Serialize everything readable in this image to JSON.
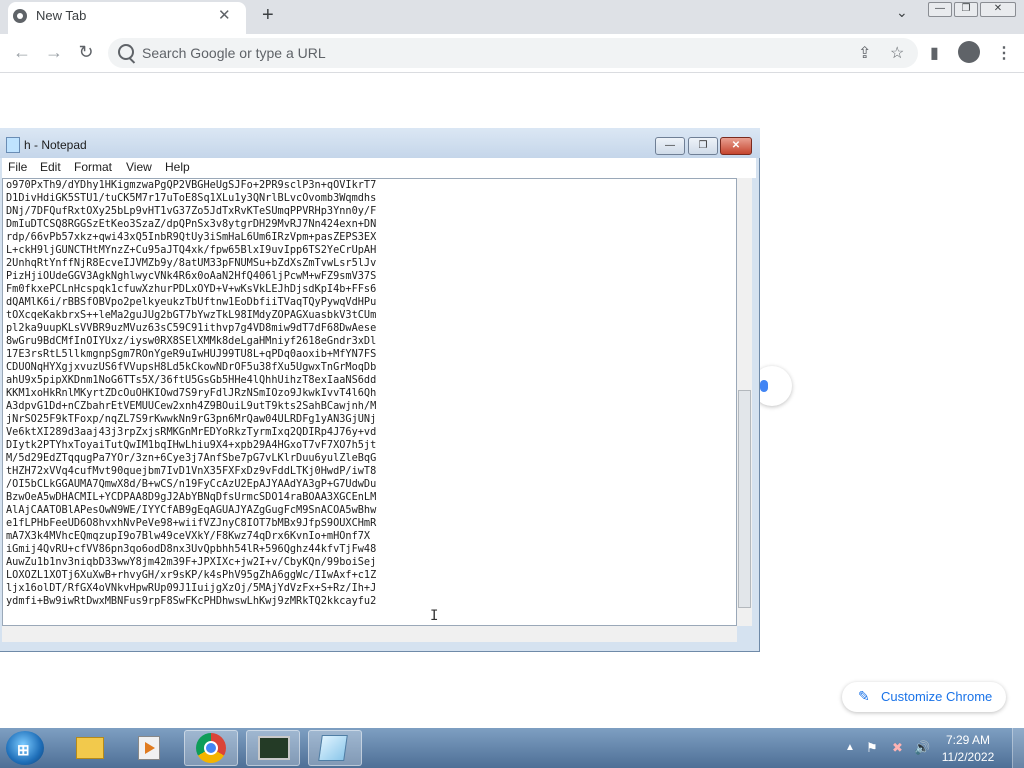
{
  "chrome": {
    "tab_title": "New Tab",
    "tab_close": "✕",
    "new_tab": "+",
    "tab_search": "⌄",
    "window_controls": [
      "—",
      "❐",
      "✕"
    ],
    "back": "←",
    "forward": "→",
    "reload": "↻",
    "omnibox_placeholder": "Search Google or type a URL",
    "share": "⇪",
    "bookmark": "☆",
    "side_panel": "▮",
    "menu": "⋮",
    "customize_label": "Customize Chrome",
    "customize_icon": "✎"
  },
  "notepad": {
    "title": "h - Notepad",
    "menu": [
      "File",
      "Edit",
      "Format",
      "View",
      "Help"
    ],
    "minimize": "—",
    "maximize": "❐",
    "close": "✕",
    "text": "o970PxTh9/dYDhy1HKigmzwaPgQP2VBGHeUgSJFo+2PR9sclP3n+qOVIkrT7\nD1DivHdiGK5STU1/tuCK5M7r17uToE8Sq1XLu1y3QNrlBLvcOvomb3Wqmdhs\nDNj/7DFQufRxtOXy25bLp9vHT1vG37Zo5JdTxRvKTeSUmqPPVRHp3Ynn0y/F\nDmIuDTCSQ8RGGSzEtKeo3SzaZ/dpQPnSx3v8ytgrDH29MvRJ7Nn424exn+DN\nrdp/66vPb57xkz+qwi43xQ5InbR9QtUy3iSmHaL6Um6IRzVpm+pasZEPS3EX\nL+ckH9ljGUNCTHtMYnzZ+Cu95aJTQ4xk/fpw65BlxI9uvIpp6TS2YeCrUpAH\n2UnhqRtYnffNjR8EcveIJVMZb9y/8atUM33pFNUMSu+bZdXsZmTvwLsr5lJv\nPizHjiOUdeGGV3AgkNghlwycVNk4R6x0oAaN2HfQ406ljPcwM+wFZ9smV37S\nFm0fkxePCLnHcspqk1cfuwXzhurPDLxOYD+V+wKsVkLEJhDjsdKpI4b+FFs6\ndQAMlK6i/rBBSfOBVpo2pelkyeukzTbUftnw1EoDbfiiTVaqTQyPywqVdHPu\ntOXcqeKakbrxS++leMa2guJUg2bGT7bYwzTkL98IMdyZOPAGXuasbkV3tCUm\npl2ka9uupKLsVVBR9uzMVuz63sC59C91ithvp7g4VD8miw9dT7dF68DwAese\n8wGru9BdCMfInOIYUxz/iysw0RX8SElXMMk8deLgaHMniyf2618eGndr3xDl\n17E3rsRtL5llkmgnpSgm7ROnYgeR9uIwHUJ99TU8L+qPDq0aoxib+MfYN7FS\nCDUONqHYXgjxvuzUS6fVVupsH8Ld5kCkowNDrOF5u38fXu5UgwxTnGrMoqDb\nahU9x5pipXKDnm1NoG6TTs5X/36ftU5GsGb5HHe4lQhhUihzT8exIaaNS6dd\nKKM1xoHkRnlMKyrtZDcOuOHKIOwd7S9ryFdlJRzNSmIOzo9JkwkIvvT4l6Qh\nA3dpvG1Dd+nCZbahrEtVEMUUCew2xnh4Z9BOuiL9utT9kts2SahBCawjnh/M\njNrSO25F9kTFoxp/nqZL7S9rKwwkNn9rG3pn6MrQaw04ULRDFg1yAN3GjUNj\nVe6ktXI289d3aaj43j3rpZxjsRMKGnMrEDYoRkzTyrmIxq2QDIRp4J76y+vd\nDIytk2PTYhxToyaiTutQwIM1bqIHwLhiu9X4+xpb29A4HGxoT7vF7XO7h5jt\nM/5d29EdZTqqugPa7YOr/3zn+6Cye3j7AnfSbe7pG7vLKlrDuu6yulZleBqG\ntHZH72xVVq4cufMvt90quejbm7IvD1VnX35FXFxDz9vFddLTKj0HwdP/iwT8\n/OI5bCLkGGAUMA7QmwX8d/B+wCS/n19FyCcAzU2EpAJYAAdYA3gP+G7UdwDu\nBzwOeA5wDHACMIL+YCDPAA8D9gJ2AbYBNqDfsUrmcSDO14raBOAA3XGCEnLM\nAlAjCAATOBlAPesOwN9WE/IYYCfAB9gEqAGUAJYAZgGugFcM9SnACOA5wBhw\ne1fLPHbFeeUD6O8hvxhNvPeVe98+wiifVZJnyC8IOT7bMBx9JfpS9OUXCHmR\nmA7X3k4MVhcEQmqzupI9o7Blw49ceVXkY/F8Kwz74qDrx6KvnIo+mHOnf7X\niGmij4QvRU+cfVV86pn3qo6odD8nx3UvQpbhh54lR+596Qghz44kfvTjFw48\nAuwZu1b1nv3niqbD33wwY8jm42m39F+JPXIXc+jw2I+v/CbyKQn/99boiSej\nLOXOZL1XOTj6XuXwB+rhvyGH/xr9sKP/k4sPhV95gZhA6ggWc/IIwAxf+c1Z\nljx16olDT/RfGX4oVNkvHpwRUp09J1IuijgXzOj/5MAjYdVzFx+S+Rz/Ih+J\nydmfi+Bw9iwRtDwxMBNFus9rpF8SwFKcPHDhwswLhKwj9zMRkTQ2kkcayfu2"
  },
  "taskbar": {
    "start": "⊞",
    "tray_up": "▲",
    "tray_icons": [
      "⚑",
      "✖",
      "🔊"
    ],
    "time": "7:29 AM",
    "date": "11/2/2022"
  }
}
